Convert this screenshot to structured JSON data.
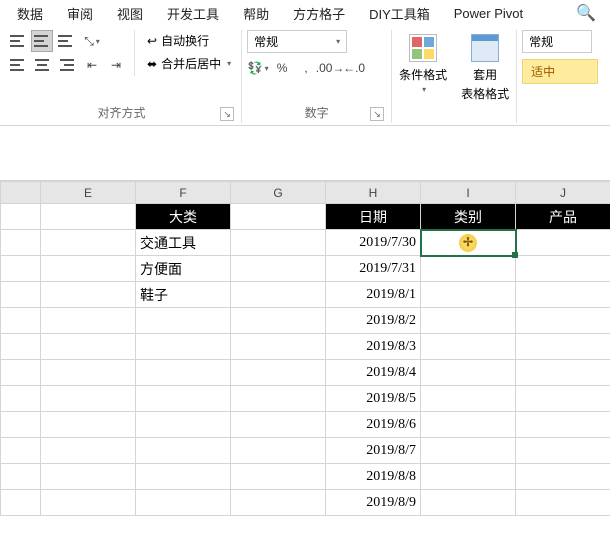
{
  "menubar": {
    "items": [
      "数据",
      "审阅",
      "视图",
      "开发工具",
      "帮助",
      "方方格子",
      "DIY工具箱",
      "Power Pivot"
    ]
  },
  "ribbon": {
    "alignment": {
      "group_label": "对齐方式",
      "wrap_text": "自动换行",
      "merge_center": "合并后居中"
    },
    "number": {
      "group_label": "数字",
      "format_selected": "常规"
    },
    "cond_format": {
      "label1": "条件格式"
    },
    "table_format": {
      "label1": "套用",
      "label2": "表格格式"
    },
    "styles": {
      "normal": "常规",
      "neutral": "适中"
    }
  },
  "grid": {
    "columns": [
      "E",
      "F",
      "G",
      "H",
      "I",
      "J"
    ],
    "header_row": {
      "F": "大类",
      "H": "日期",
      "I": "类别",
      "J": "产品"
    },
    "col_F": [
      "交通工具",
      "方便面",
      "鞋子"
    ],
    "col_H": [
      "2019/7/30",
      "2019/7/31",
      "2019/8/1",
      "2019/8/2",
      "2019/8/3",
      "2019/8/4",
      "2019/8/5",
      "2019/8/6",
      "2019/8/7",
      "2019/8/8",
      "2019/8/9"
    ]
  }
}
